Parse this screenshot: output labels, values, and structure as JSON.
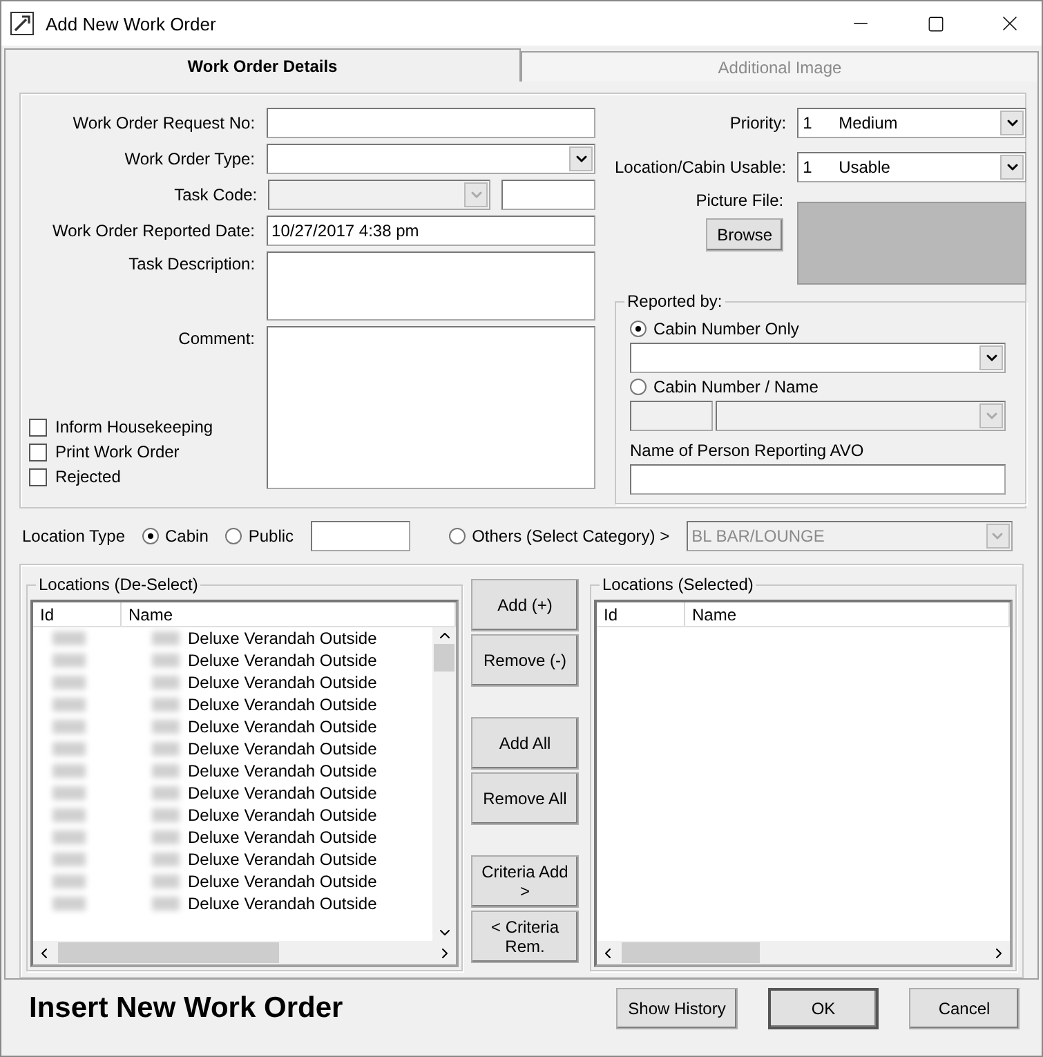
{
  "window": {
    "title": "Add New Work Order"
  },
  "tabs": [
    {
      "label": "Work Order Details",
      "selected": true
    },
    {
      "label": "Additional Image",
      "selected": false
    }
  ],
  "fields": [
    {
      "kind": "text",
      "label": "Work Order Request No:"
    },
    {
      "kind": "dropdown",
      "label": "Work Order Type:"
    },
    {
      "kind": "code",
      "label": "Task Code:",
      "disabled": true
    },
    {
      "kind": "text",
      "label": "Work Order Reported Date:",
      "value": "10/27/2017 4:38 pm"
    },
    {
      "kind": "area",
      "label": "Task Description:"
    },
    {
      "kind": "comment",
      "label": "Comment:"
    }
  ],
  "checkboxes": [
    {
      "label": "Inform Housekeeping",
      "checked": false
    },
    {
      "label": "Print Work Order",
      "checked": false
    },
    {
      "label": "Rejected",
      "checked": false
    }
  ],
  "combos": [
    {
      "label": "Priority:",
      "code": "1",
      "value": "Medium"
    },
    {
      "label": "Location/Cabin Usable:",
      "code": "1",
      "value": "Usable"
    }
  ],
  "picture_file": {
    "label": "Picture File:",
    "button": "Browse"
  },
  "reported_by": {
    "title": "Reported by:",
    "options": [
      {
        "label": "Cabin Number Only",
        "selected": true
      },
      {
        "label": "Cabin Number / Name",
        "selected": false
      }
    ],
    "person_label": "Name of Person Reporting AVO"
  },
  "location_type": {
    "label": "Location Type",
    "options": [
      {
        "label": "Cabin",
        "selected": true
      },
      {
        "label": "Public",
        "selected": false
      }
    ],
    "other": {
      "label": "Others (Select Category) >",
      "selected": false
    },
    "category": "BL BAR/LOUNGE"
  },
  "locations_deselect": {
    "title": "Locations (De-Select)",
    "columns": [
      "Id",
      "Name"
    ],
    "rows": [
      "Deluxe Verandah Outside",
      "Deluxe Verandah Outside",
      "Deluxe Verandah Outside",
      "Deluxe Verandah Outside",
      "Deluxe Verandah Outside",
      "Deluxe Verandah Outside",
      "Deluxe Verandah Outside",
      "Deluxe Verandah Outside",
      "Deluxe Verandah Outside",
      "Deluxe Verandah Outside",
      "Deluxe Verandah Outside",
      "Deluxe Verandah Outside",
      "Deluxe Verandah Outside"
    ]
  },
  "transfer_buttons": [
    [
      "Add (+)",
      "Remove (-)"
    ],
    [
      "Add All",
      "Remove All"
    ],
    [
      "Criteria Add >",
      "< Criteria Rem."
    ]
  ],
  "locations_selected": {
    "title": "Locations (Selected)",
    "columns": [
      "Id",
      "Name"
    ]
  },
  "status_text": "Insert New Work Order",
  "dialog_buttons": [
    "Show History",
    "OK",
    "Cancel"
  ]
}
